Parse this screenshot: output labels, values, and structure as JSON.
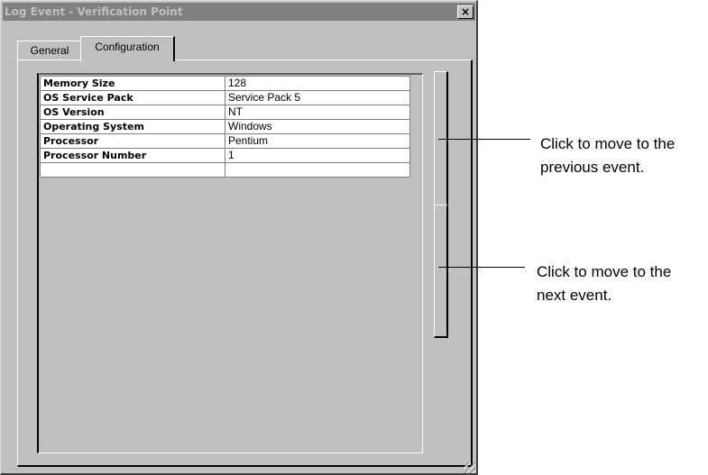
{
  "window": {
    "title": "Log Event - Verification Point",
    "close_label": "×"
  },
  "tabs": [
    {
      "label": "General",
      "active": false
    },
    {
      "label": "Configuration",
      "active": true
    }
  ],
  "properties": {
    "rows": [
      {
        "name": "Memory Size",
        "value": "128"
      },
      {
        "name": "OS Service Pack",
        "value": "Service Pack 5"
      },
      {
        "name": "OS Version",
        "value": "NT"
      },
      {
        "name": "Operating System",
        "value": "Windows"
      },
      {
        "name": "Processor",
        "value": "Pentium"
      },
      {
        "name": "Processor Number",
        "value": "1"
      },
      {
        "name": "",
        "value": ""
      }
    ]
  },
  "navigation": {
    "previous_label": "",
    "next_label": ""
  },
  "callouts": {
    "previous": "Click to move to the\nprevious event.",
    "next": "Click to move to the\nnext event."
  },
  "colors": {
    "window_face": "#c0c0c0",
    "title_inactive": "#808080"
  }
}
